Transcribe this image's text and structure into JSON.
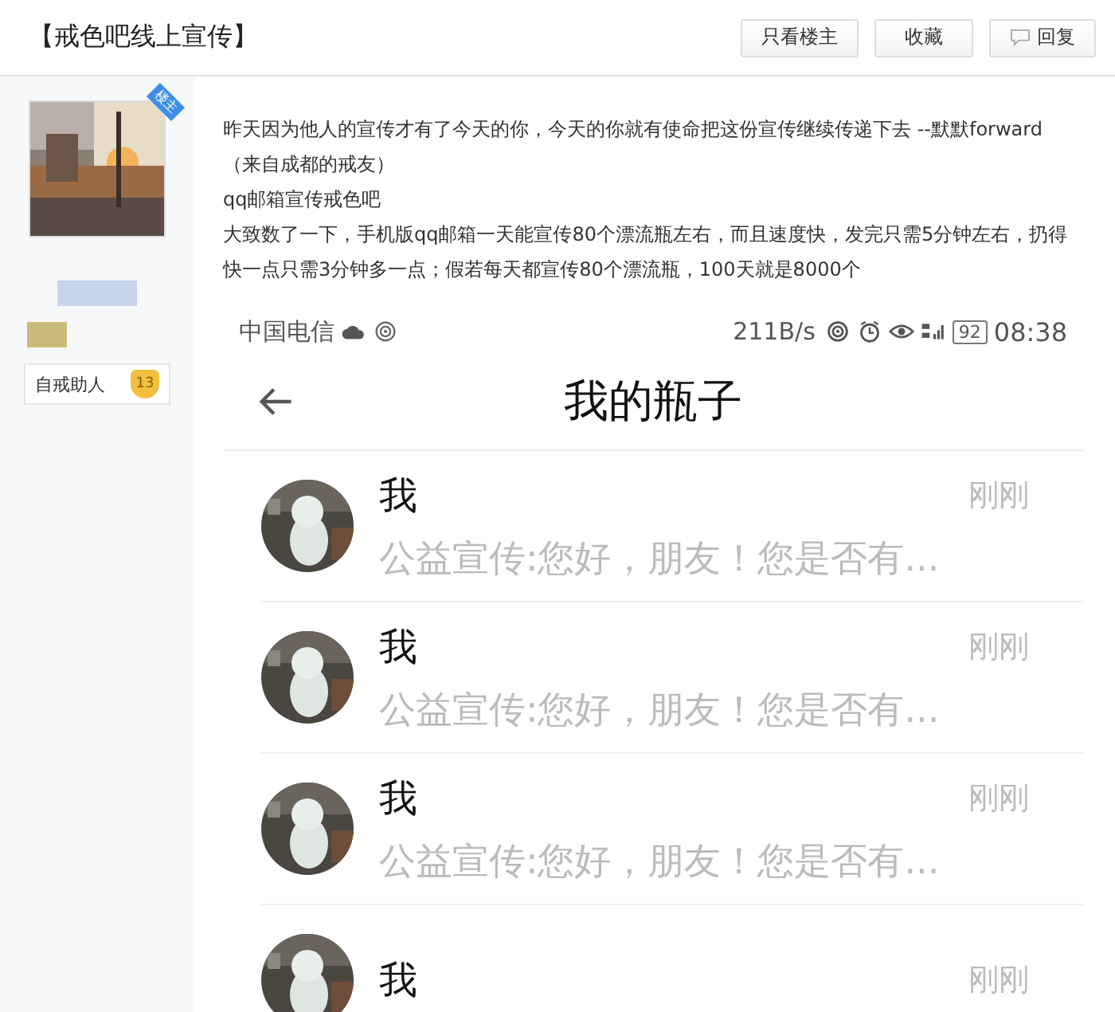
{
  "thread": {
    "title": "【戒色吧线上宣传】",
    "buttons": [
      {
        "label": "只看楼主",
        "kind": "plain"
      },
      {
        "label": "收藏",
        "kind": "plain"
      },
      {
        "label": "回复",
        "kind": "reply"
      }
    ]
  },
  "author": {
    "badge": "楼主",
    "title": "自戒助人",
    "level": "13"
  },
  "post": {
    "paragraphs": [
      "昨天因为他人的宣传才有了今天的你，今天的你就有使命把这份宣传继续传递下去 --默默forward（来自成都的戒友）",
      "qq邮箱宣传戒色吧",
      "大致数了一下，手机版qq邮箱一天能宣传80个漂流瓶左右，而且速度快，发完只需5分钟左右，扔得快一点只需3分钟多一点；假若每天都宣传80个漂流瓶，100天就是8000个"
    ]
  },
  "screenshot": {
    "status_bar": {
      "carrier": "中国电信",
      "speed": "211B/s",
      "battery": "92",
      "time": "08:38"
    },
    "title": "我的瓶子",
    "rows": [
      {
        "name": "我",
        "time": "刚刚",
        "preview": "公益宣传:您好，朋友！您是否有..."
      },
      {
        "name": "我",
        "time": "刚刚",
        "preview": "公益宣传:您好，朋友！您是否有..."
      },
      {
        "name": "我",
        "time": "刚刚",
        "preview": "公益宣传:您好，朋友！您是否有..."
      },
      {
        "name": "我",
        "time": "刚刚"
      }
    ]
  }
}
